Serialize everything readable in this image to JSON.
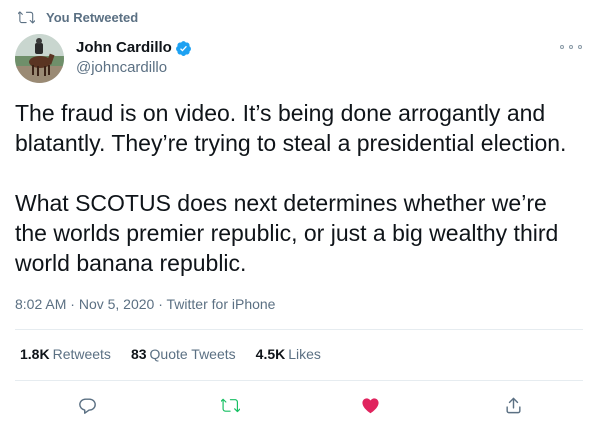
{
  "retweet_context": {
    "label": "You Retweeted",
    "icon": "retweet-icon"
  },
  "author": {
    "name": "John Cardillo",
    "handle": "@johncardillo",
    "verified": true,
    "avatar_icon": "horse-rider-avatar"
  },
  "tweet": {
    "paragraph_1": "The fraud is on video. It’s being done arrogantly and blatantly. They’re trying to steal a presidential election.",
    "paragraph_2": "What SCOTUS does next determines whether we’re the worlds premier republic, or just a big wealthy third world banana republic."
  },
  "meta": {
    "time": "8:02 AM",
    "sep1": " · ",
    "date": "Nov 5, 2020",
    "sep2": " · ",
    "source": "Twitter for iPhone"
  },
  "stats": {
    "retweets_count": "1.8K",
    "retweets_label": "Retweets",
    "quotes_count": "83",
    "quotes_label": "Quote Tweets",
    "likes_count": "4.5K",
    "likes_label": "Likes"
  },
  "actions": {
    "reply_icon": "reply-icon",
    "retweet_icon": "retweet-icon",
    "like_icon": "heart-icon",
    "share_icon": "share-icon",
    "retweet_active_color": "#17bf63",
    "like_active_color": "#e0245e"
  },
  "colors": {
    "text": "#0f1419",
    "secondary": "#5b7083",
    "verified": "#1da1f2",
    "divider": "#e6ecf0"
  }
}
